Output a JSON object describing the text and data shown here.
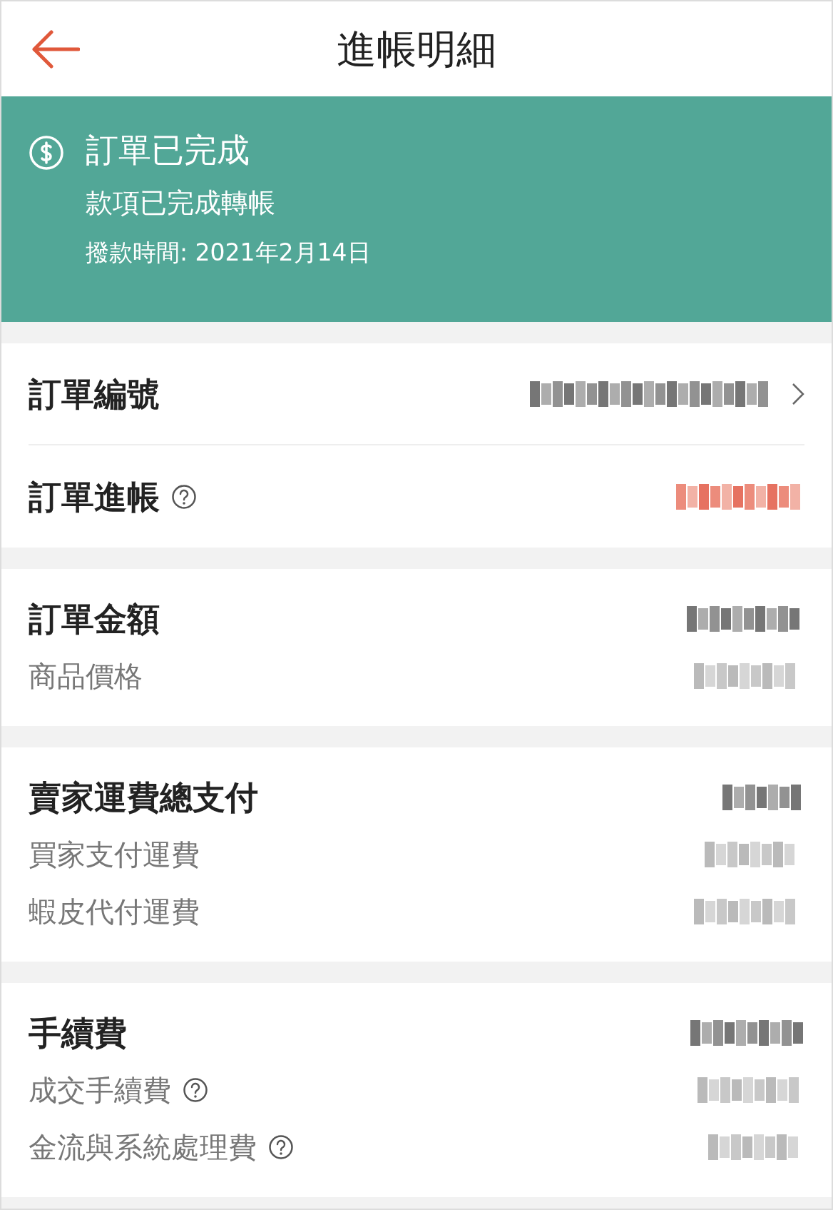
{
  "header": {
    "title": "進帳明細"
  },
  "status": {
    "title": "訂單已完成",
    "message": "款項已完成轉帳",
    "date": "撥款時間: 2021年2月14日"
  },
  "sections": [
    {
      "rows": [
        {
          "label": "訂單編號",
          "kind": "main",
          "help": false,
          "chevron": true,
          "emphasized": false
        },
        {
          "label": "訂單進帳",
          "kind": "main",
          "help": true,
          "chevron": false,
          "emphasized": true
        }
      ]
    },
    {
      "rows": [
        {
          "label": "訂單金額",
          "kind": "main",
          "help": false,
          "chevron": false,
          "emphasized": false
        },
        {
          "label": "商品價格",
          "kind": "sub",
          "help": false,
          "chevron": false,
          "emphasized": false
        }
      ]
    },
    {
      "rows": [
        {
          "label": "賣家運費總支付",
          "kind": "main",
          "help": false,
          "chevron": false,
          "emphasized": false
        },
        {
          "label": "買家支付運費",
          "kind": "sub",
          "help": false,
          "chevron": false,
          "emphasized": false
        },
        {
          "label": "蝦皮代付運費",
          "kind": "sub",
          "help": false,
          "chevron": false,
          "emphasized": false
        }
      ]
    },
    {
      "rows": [
        {
          "label": "手續費",
          "kind": "main",
          "help": false,
          "chevron": false,
          "emphasized": false
        },
        {
          "label": "成交手續費",
          "kind": "sub",
          "help": true,
          "chevron": false,
          "emphasized": false
        },
        {
          "label": "金流與系統處理費",
          "kind": "sub",
          "help": true,
          "chevron": false,
          "emphasized": false
        }
      ]
    }
  ]
}
